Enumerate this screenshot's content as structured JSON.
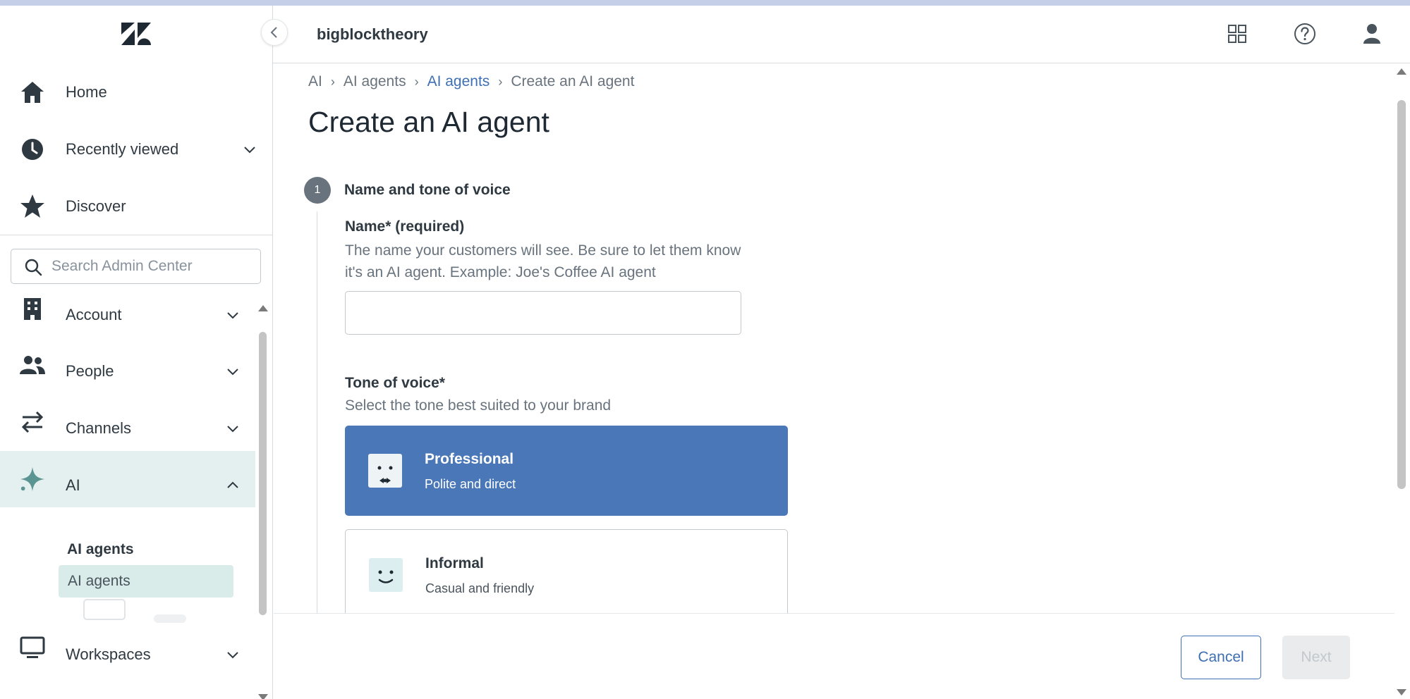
{
  "header": {
    "account_name": "bigblocktheory",
    "icons": [
      "apps-grid-icon",
      "help-icon",
      "user-profile-icon"
    ]
  },
  "sidebar": {
    "logo": "zendesk-logo",
    "top_items": [
      {
        "label": "Home",
        "icon": "home-icon"
      },
      {
        "label": "Recently viewed",
        "icon": "clock-icon"
      },
      {
        "label": "Discover",
        "icon": "star-icon"
      }
    ],
    "search": {
      "placeholder": "Search Admin Center",
      "value": ""
    },
    "sections": [
      {
        "label": "Account",
        "icon": "building-icon",
        "expanded": false
      },
      {
        "label": "People",
        "icon": "people-icon",
        "expanded": false
      },
      {
        "label": "Channels",
        "icon": "arrows-icon",
        "expanded": false
      },
      {
        "label": "AI",
        "icon": "sparkle-icon",
        "expanded": true
      },
      {
        "label": "Workspaces",
        "icon": "monitor-icon",
        "expanded": false
      }
    ],
    "ai_submenu": {
      "group_title": "AI agents",
      "items": [
        {
          "label": "AI agents",
          "selected": true
        }
      ]
    }
  },
  "main": {
    "breadcrumb": [
      "AI",
      "AI agents",
      "AI agents",
      "Create an AI agent"
    ],
    "title": "Create an AI agent",
    "step": {
      "number": "1",
      "title": "Name and tone of voice"
    },
    "name_field": {
      "label": "Name* (required)",
      "hint_line1": "The name your customers will see. Be sure to let them know",
      "hint_line2": "it's an AI agent. Example: Joe's Coffee AI agent",
      "value": ""
    },
    "tone_field": {
      "label": "Tone of voice*",
      "hint": "Select the tone best suited to your brand",
      "options": [
        {
          "title": "Professional",
          "subtitle": "Polite and direct",
          "selected": true
        },
        {
          "title": "Informal",
          "subtitle": "Casual and friendly",
          "selected": false
        }
      ]
    }
  },
  "footer": {
    "cancel_label": "Cancel",
    "next_label": "Next"
  },
  "colors": {
    "accent_blue": "#3e6fb2",
    "selected_card": "#4a77b8",
    "active_nav_bg": "#e4f0ef",
    "ai_icon": "#5b9591"
  }
}
